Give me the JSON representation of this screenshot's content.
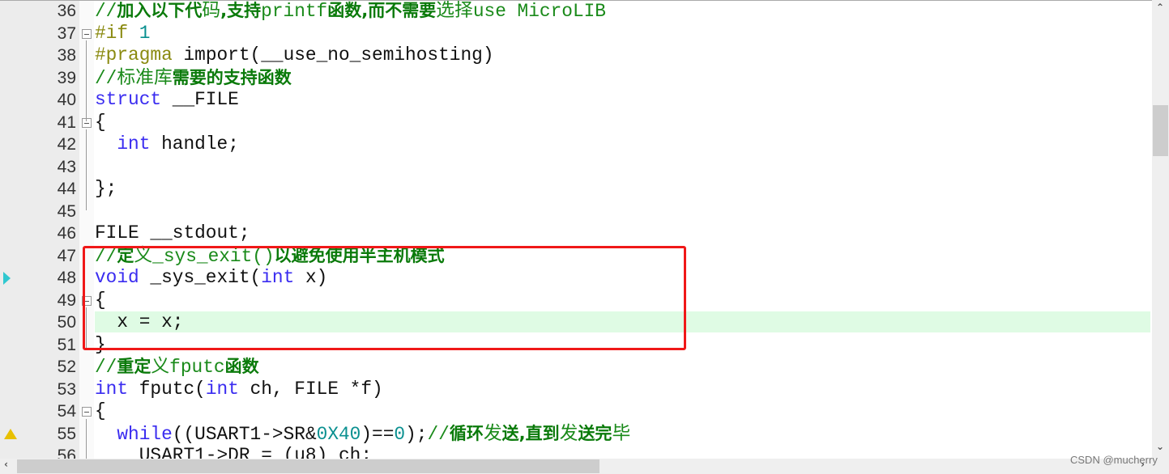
{
  "editor": {
    "lines": [
      {
        "no": "36",
        "tokens": [
          [
            "//",
            "c"
          ],
          [
            "加入以下代",
            "cb"
          ],
          [
            "码",
            "c"
          ],
          [
            ",支持",
            "cb"
          ],
          [
            "printf",
            "c"
          ],
          [
            "函数,而不需要",
            "cb"
          ],
          [
            "选择",
            "c"
          ],
          [
            "use MicroLIB",
            "c"
          ]
        ]
      },
      {
        "no": "37",
        "fold": true,
        "tokens": [
          [
            "#if ",
            "p"
          ],
          [
            "1",
            "n"
          ]
        ]
      },
      {
        "no": "38",
        "tokens": [
          [
            "#pragma ",
            "p"
          ],
          [
            "import(__use_no_semihosting)",
            "t"
          ]
        ]
      },
      {
        "no": "39",
        "tokens": [
          [
            "//标准库",
            "c"
          ],
          [
            "需要的支持函数",
            "cb"
          ]
        ]
      },
      {
        "no": "40",
        "tokens": [
          [
            "struct ",
            "k"
          ],
          [
            "__FILE",
            "t"
          ]
        ]
      },
      {
        "no": "41",
        "fold": true,
        "tokens": [
          [
            "{",
            "t"
          ]
        ]
      },
      {
        "no": "42",
        "tokens": [
          [
            "  ",
            "t"
          ],
          [
            "int ",
            "k"
          ],
          [
            "handle;",
            "t"
          ]
        ]
      },
      {
        "no": "43",
        "tokens": []
      },
      {
        "no": "44",
        "tokens": [
          [
            "};",
            "t"
          ]
        ]
      },
      {
        "no": "45",
        "tokens": []
      },
      {
        "no": "46",
        "tokens": [
          [
            "FILE __stdout;",
            "t"
          ]
        ]
      },
      {
        "no": "47",
        "tokens": [
          [
            "//",
            "c"
          ],
          [
            "定",
            "cb"
          ],
          [
            "义_sys_exit()",
            "c"
          ],
          [
            "以避免使用半主机模式",
            "cb"
          ]
        ]
      },
      {
        "no": "48",
        "marker": "arrow",
        "tokens": [
          [
            "void ",
            "k"
          ],
          [
            "_sys_exit(",
            "t"
          ],
          [
            "int ",
            "k"
          ],
          [
            "x)",
            "t"
          ]
        ]
      },
      {
        "no": "49",
        "fold": true,
        "tokens": [
          [
            "{",
            "t"
          ]
        ]
      },
      {
        "no": "50",
        "highlight": true,
        "tokens": [
          [
            "  x = x;",
            "t"
          ]
        ]
      },
      {
        "no": "51",
        "tokens": [
          [
            "}",
            "t"
          ]
        ]
      },
      {
        "no": "52",
        "tokens": [
          [
            "//",
            "c"
          ],
          [
            "重定",
            "cb"
          ],
          [
            "义fputc",
            "c"
          ],
          [
            "函数",
            "cb"
          ]
        ]
      },
      {
        "no": "53",
        "tokens": [
          [
            "int ",
            "k"
          ],
          [
            "fputc(",
            "t"
          ],
          [
            "int ",
            "k"
          ],
          [
            "ch, FILE *f)",
            "t"
          ]
        ]
      },
      {
        "no": "54",
        "fold": true,
        "tokens": [
          [
            "{",
            "t"
          ]
        ]
      },
      {
        "no": "55",
        "marker": "warning",
        "tokens": [
          [
            "  ",
            "t"
          ],
          [
            "while",
            "k"
          ],
          [
            "((USART1->SR&",
            "t"
          ],
          [
            "0X40",
            "n"
          ],
          [
            ")==",
            "t"
          ],
          [
            "0",
            "n"
          ],
          [
            ");",
            "t"
          ],
          [
            "//",
            "c"
          ],
          [
            "循环",
            "cb"
          ],
          [
            "发",
            "c"
          ],
          [
            "送,直到",
            "cb"
          ],
          [
            "发",
            "c"
          ],
          [
            "送完",
            "cb"
          ],
          [
            "毕",
            "c"
          ]
        ]
      },
      {
        "no": "56",
        "tokens": [
          [
            "    USART1->DR = (u8) ch;",
            "t"
          ]
        ]
      }
    ]
  },
  "colors": {
    "comment": "#1a8a1a",
    "keyword": "#3a2cf0",
    "preprocessor": "#8a8a10",
    "number": "#0a9090",
    "highlight": "#dffbe4",
    "annotation_box": "#f01818"
  },
  "scrollbars": {
    "up": "⌃",
    "down": "⌄",
    "left": "‹",
    "right": "›"
  },
  "watermark": "CSDN @mucherry"
}
